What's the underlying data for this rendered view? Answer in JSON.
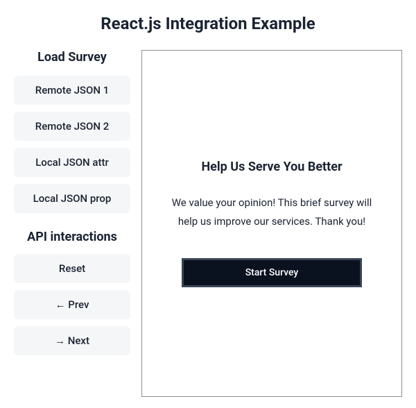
{
  "page_title": "React.js Integration Example",
  "sidebar": {
    "load_heading": "Load Survey",
    "load_buttons": [
      {
        "label": "Remote JSON 1"
      },
      {
        "label": "Remote JSON 2"
      },
      {
        "label": "Local JSON attr"
      },
      {
        "label": "Local JSON prop"
      }
    ],
    "api_heading": "API interactions",
    "api_buttons": [
      {
        "label": "Reset"
      },
      {
        "label": "← Prev"
      },
      {
        "label": "→ Next"
      }
    ]
  },
  "survey": {
    "title": "Help Us Serve You Better",
    "description": "We value your opinion! This brief survey will help us improve our services. Thank you!",
    "start_label": "Start Survey"
  }
}
